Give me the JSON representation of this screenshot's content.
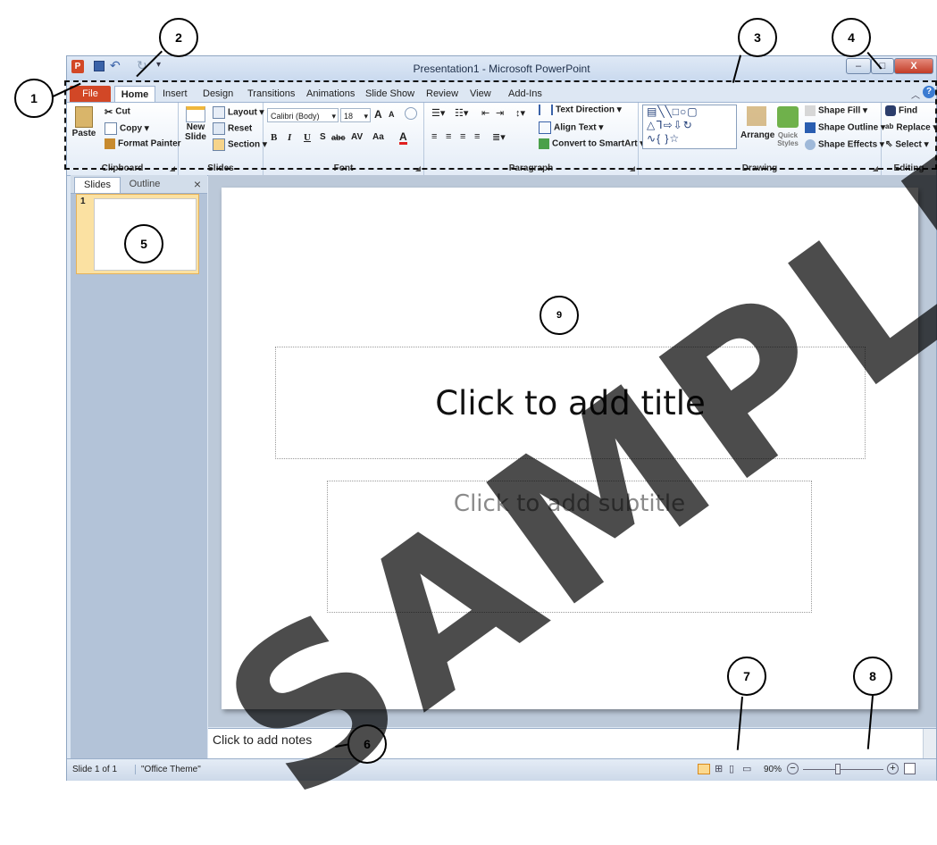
{
  "window": {
    "title": "Presentation1 - Microsoft PowerPoint"
  },
  "quick_access": {
    "app_icon": "P"
  },
  "window_controls": {
    "minimize": "–",
    "maximize": "□",
    "close": "X"
  },
  "tabs": [
    "File",
    "Home",
    "Insert",
    "Design",
    "Transitions",
    "Animations",
    "Slide Show",
    "Review",
    "View",
    "Add-Ins"
  ],
  "ribbon": {
    "clipboard": {
      "paste": "Paste",
      "cut": "Cut",
      "copy": "Copy",
      "format_painter": "Format Painter",
      "label": "Clipboard"
    },
    "slides": {
      "new_slide": "New Slide",
      "layout": "Layout",
      "reset": "Reset",
      "section": "Section",
      "label": "Slides"
    },
    "font": {
      "family": "Calibri (Body)",
      "size": "18",
      "grow": "A",
      "shrink": "A",
      "bold": "B",
      "italic": "I",
      "underline": "U",
      "shadow": "S",
      "strike": "abc",
      "spacing": "AV",
      "case": "Aa",
      "color": "A",
      "label": "Font"
    },
    "paragraph": {
      "text_direction": "Text Direction",
      "align_text": "Align Text",
      "convert": "Convert to SmartArt",
      "label": "Paragraph"
    },
    "drawing": {
      "arrange": "Arrange",
      "quick_styles": "Quick Styles",
      "shape_fill": "Shape Fill",
      "shape_outline": "Shape Outline",
      "shape_effects": "Shape Effects",
      "label": "Drawing"
    },
    "editing": {
      "find": "Find",
      "replace": "Replace",
      "select": "Select",
      "label": "Editing"
    }
  },
  "pane": {
    "slides_tab": "Slides",
    "outline_tab": "Outline",
    "close": "×",
    "slide_number": "1"
  },
  "slide": {
    "title_placeholder": "Click to add title",
    "subtitle_placeholder": "Click to add subtitle"
  },
  "notes": {
    "placeholder": "Click to add notes"
  },
  "status": {
    "slide_count": "Slide 1 of 1",
    "theme": "\"Office Theme\"",
    "zoom": "90%"
  },
  "annotations": [
    "1",
    "2",
    "3",
    "4",
    "5",
    "6",
    "7",
    "8",
    "9"
  ],
  "watermark": "SAMPLE",
  "colors": {
    "file_tab": "#d24726",
    "ribbon_bg": "#e3ecf7",
    "slide_area": "#bcc9d9",
    "thumb_selected": "#fbe1a2"
  }
}
